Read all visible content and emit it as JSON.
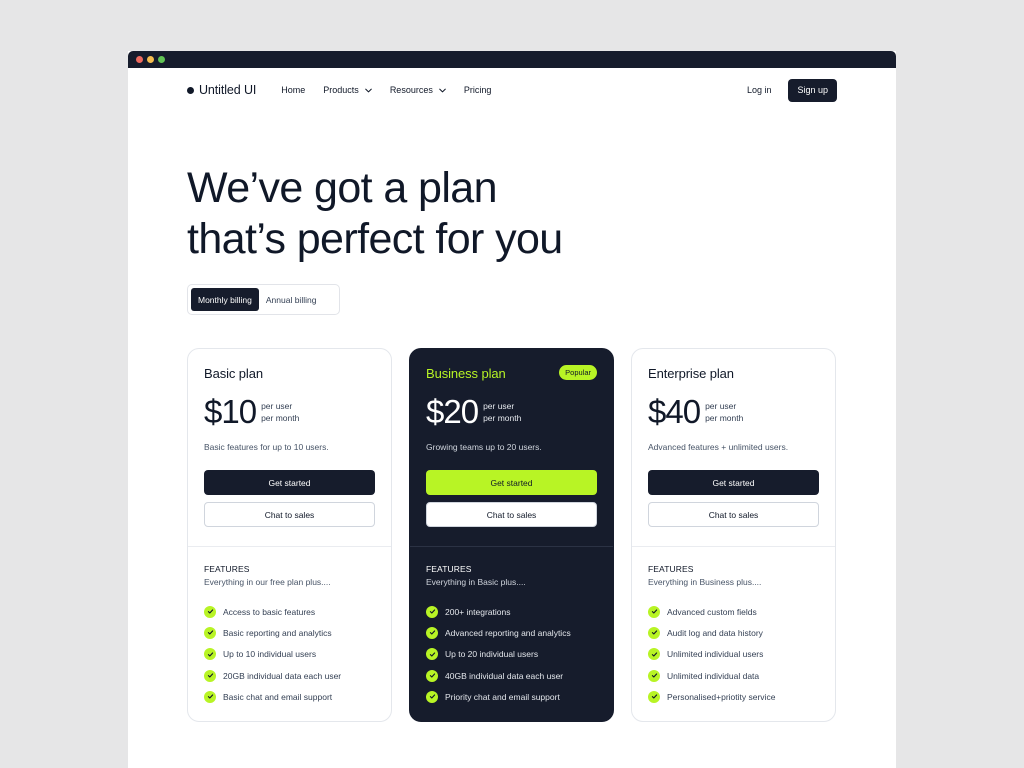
{
  "brand": {
    "name": "Untitled UI"
  },
  "nav": {
    "links": [
      {
        "label": "Home"
      },
      {
        "label": "Products"
      },
      {
        "label": "Resources"
      },
      {
        "label": "Pricing"
      }
    ],
    "login": "Log in",
    "signup": "Sign up"
  },
  "hero": {
    "line1": "We’ve got a plan",
    "line2": "that’s perfect for you"
  },
  "billing": {
    "options": [
      "Monthly billing",
      "Annual billing"
    ],
    "selected": "Monthly billing"
  },
  "colors": {
    "accent": "#b8f425",
    "dark": "#161c2c"
  },
  "plans": [
    {
      "name": "Basic plan",
      "price": "$10",
      "per_line1": "per user",
      "per_line2": "per month",
      "description": "Basic features for up to 10 users.",
      "primary_cta": "Get started",
      "secondary_cta": "Chat to sales",
      "features_title": "FEATURES",
      "features_sub": "Everything in our free plan plus....",
      "features": [
        "Access to basic features",
        "Basic reporting and analytics",
        "Up to 10 individual users",
        "20GB individual data each user",
        "Basic chat and email support"
      ]
    },
    {
      "name": "Business plan",
      "badge": "Popular",
      "price": "$20",
      "per_line1": "per user",
      "per_line2": "per month",
      "description": "Growing teams up to 20 users.",
      "primary_cta": "Get started",
      "secondary_cta": "Chat to sales",
      "features_title": "FEATURES",
      "features_sub": "Everything in Basic plus....",
      "features": [
        "200+ integrations",
        "Advanced reporting and analytics",
        "Up to 20 individual users",
        "40GB individual data each user",
        "Priority chat and email support"
      ]
    },
    {
      "name": "Enterprise plan",
      "price": "$40",
      "per_line1": "per user",
      "per_line2": "per month",
      "description": "Advanced features + unlimited users.",
      "primary_cta": "Get started",
      "secondary_cta": "Chat to sales",
      "features_title": "FEATURES",
      "features_sub": "Everything in Business plus....",
      "features": [
        "Advanced custom fields",
        "Audit log and data history",
        "Unlimited individual users",
        "Unlimited individual data",
        "Personalised+priotity service"
      ]
    }
  ]
}
